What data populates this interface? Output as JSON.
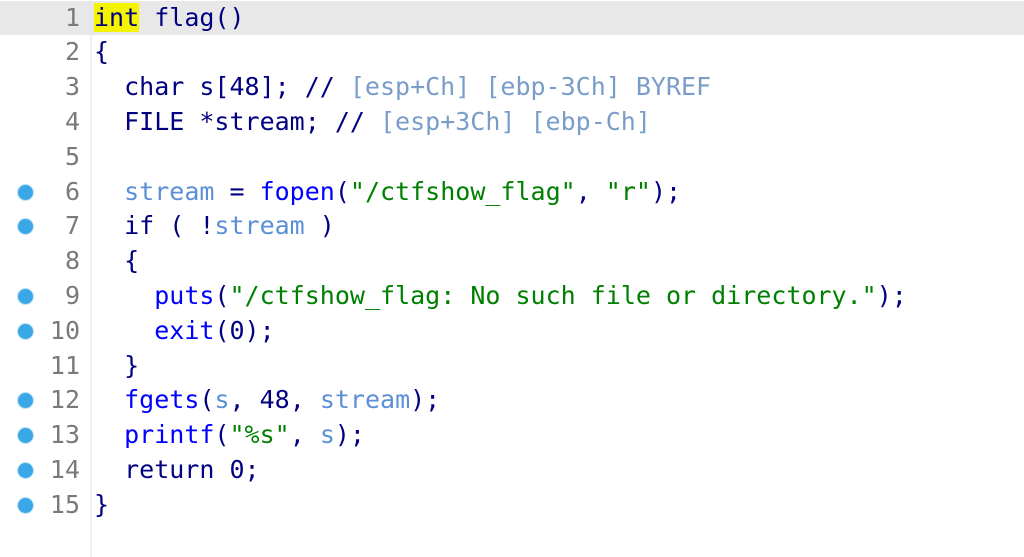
{
  "editor": {
    "lines": [
      {
        "number": "1",
        "breakpoint": false,
        "current": true,
        "tokens": [
          [
            "kw-hl",
            "int"
          ],
          [
            "punc",
            " "
          ],
          [
            "punc",
            "flag()"
          ]
        ]
      },
      {
        "number": "2",
        "breakpoint": false,
        "current": false,
        "tokens": [
          [
            "punc",
            "{"
          ]
        ]
      },
      {
        "number": "3",
        "breakpoint": false,
        "current": false,
        "tokens": [
          [
            "punc",
            "  char s[48]; // "
          ],
          [
            "cmt",
            "[esp+Ch] [ebp-3Ch] BYREF"
          ]
        ]
      },
      {
        "number": "4",
        "breakpoint": false,
        "current": false,
        "tokens": [
          [
            "punc",
            "  FILE *stream; // "
          ],
          [
            "cmt",
            "[esp+3Ch] [ebp-Ch]"
          ]
        ]
      },
      {
        "number": "5",
        "breakpoint": false,
        "current": false,
        "tokens": []
      },
      {
        "number": "6",
        "breakpoint": true,
        "current": false,
        "tokens": [
          [
            "punc",
            "  "
          ],
          [
            "var",
            "stream"
          ],
          [
            "punc",
            " = "
          ],
          [
            "fn",
            "fopen"
          ],
          [
            "punc",
            "("
          ],
          [
            "str",
            "\"/ctfshow_flag\""
          ],
          [
            "punc",
            ", "
          ],
          [
            "str",
            "\"r\""
          ],
          [
            "punc",
            ");"
          ]
        ]
      },
      {
        "number": "7",
        "breakpoint": true,
        "current": false,
        "tokens": [
          [
            "punc",
            "  if ( !"
          ],
          [
            "var",
            "stream"
          ],
          [
            "punc",
            " )"
          ]
        ]
      },
      {
        "number": "8",
        "breakpoint": false,
        "current": false,
        "tokens": [
          [
            "punc",
            "  {"
          ]
        ]
      },
      {
        "number": "9",
        "breakpoint": true,
        "current": false,
        "tokens": [
          [
            "punc",
            "    "
          ],
          [
            "fn",
            "puts"
          ],
          [
            "punc",
            "("
          ],
          [
            "str",
            "\"/ctfshow_flag: No such file or directory.\""
          ],
          [
            "punc",
            ");"
          ]
        ]
      },
      {
        "number": "10",
        "breakpoint": true,
        "current": false,
        "tokens": [
          [
            "punc",
            "    "
          ],
          [
            "fn",
            "exit"
          ],
          [
            "punc",
            "(0);"
          ]
        ]
      },
      {
        "number": "11",
        "breakpoint": false,
        "current": false,
        "tokens": [
          [
            "punc",
            "  }"
          ]
        ]
      },
      {
        "number": "12",
        "breakpoint": true,
        "current": false,
        "tokens": [
          [
            "punc",
            "  "
          ],
          [
            "fn",
            "fgets"
          ],
          [
            "punc",
            "("
          ],
          [
            "var",
            "s"
          ],
          [
            "punc",
            ", 48, "
          ],
          [
            "var",
            "stream"
          ],
          [
            "punc",
            ");"
          ]
        ]
      },
      {
        "number": "13",
        "breakpoint": true,
        "current": false,
        "tokens": [
          [
            "punc",
            "  "
          ],
          [
            "fn",
            "printf"
          ],
          [
            "punc",
            "("
          ],
          [
            "str",
            "\"%s\""
          ],
          [
            "punc",
            ", "
          ],
          [
            "var",
            "s"
          ],
          [
            "punc",
            ");"
          ]
        ]
      },
      {
        "number": "14",
        "breakpoint": true,
        "current": false,
        "tokens": [
          [
            "punc",
            "  return 0;"
          ]
        ]
      },
      {
        "number": "15",
        "breakpoint": true,
        "current": false,
        "tokens": [
          [
            "punc",
            "}"
          ]
        ]
      }
    ]
  },
  "colors": {
    "breakpoint_dot": "#3aa7e6",
    "keyword_highlight": "#f4f400",
    "current_line": "#e8e8e8",
    "string": "#008000",
    "function": "#0000ff",
    "variable": "#5b8fd6",
    "comment": "#7a9cc8"
  }
}
